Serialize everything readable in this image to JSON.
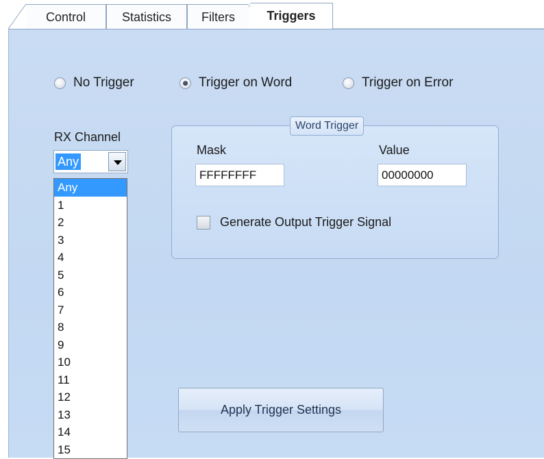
{
  "tabs": [
    {
      "label": "Control"
    },
    {
      "label": "Statistics"
    },
    {
      "label": "Filters"
    },
    {
      "label": "Triggers",
      "active": true
    }
  ],
  "trigger_mode": {
    "options": [
      "No Trigger",
      "Trigger on Word",
      "Trigger on Error"
    ],
    "selected": "Trigger on Word"
  },
  "rx_channel": {
    "label": "RX Channel",
    "value": "Any",
    "options": [
      "Any",
      "1",
      "2",
      "3",
      "4",
      "5",
      "6",
      "7",
      "8",
      "9",
      "10",
      "11",
      "12",
      "13",
      "14",
      "15"
    ]
  },
  "word_trigger": {
    "title": "Word Trigger",
    "mask_label": "Mask",
    "mask_value": "FFFFFFFF",
    "value_label": "Value",
    "value_value": "00000000",
    "generate_output_label": "Generate Output Trigger Signal",
    "generate_output_checked": false
  },
  "apply_button": {
    "label": "Apply Trigger Settings"
  },
  "colors": {
    "panel": "#c6daf3",
    "selection": "#3399ff",
    "tab_border": "#8ea7c3"
  }
}
